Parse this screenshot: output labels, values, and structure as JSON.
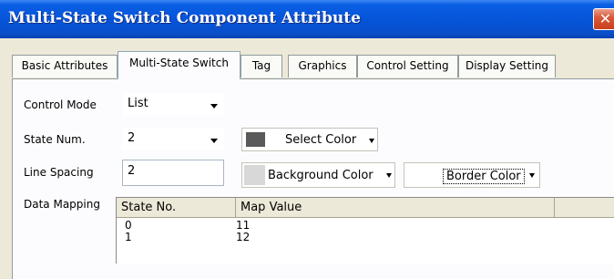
{
  "window": {
    "title": "Multi-State Switch Component Attribute",
    "close_glyph": "✕"
  },
  "tabs": [
    {
      "label": "Basic Attributes",
      "active": false
    },
    {
      "label": "Multi-State Switch",
      "active": true
    },
    {
      "label": "Tag",
      "active": false
    },
    {
      "label": "Graphics",
      "active": false
    },
    {
      "label": "Control Setting",
      "active": false
    },
    {
      "label": "Display Setting",
      "active": false
    }
  ],
  "form": {
    "control_mode": {
      "label": "Control Mode",
      "value": "List"
    },
    "state_num": {
      "label": "State Num.",
      "value": "2"
    },
    "line_spacing": {
      "label": "Line Spacing",
      "value": "2"
    },
    "select_color": {
      "label": "Select Color",
      "swatch": "#5a5a5a"
    },
    "background_color": {
      "label": "Background Color",
      "swatch": "#d8d8d8"
    },
    "border_color": {
      "label": "Border Color",
      "swatch": "#ffffff"
    }
  },
  "data_mapping": {
    "label": "Data Mapping",
    "columns": [
      "State No.",
      "Map Value"
    ],
    "rows": [
      {
        "state": "0",
        "value": "11"
      },
      {
        "state": "1",
        "value": "12"
      }
    ]
  },
  "colors": {
    "title_bar": "#0553d8",
    "close_button": "#d8593a",
    "dialog_bg": "#ece9d8"
  }
}
